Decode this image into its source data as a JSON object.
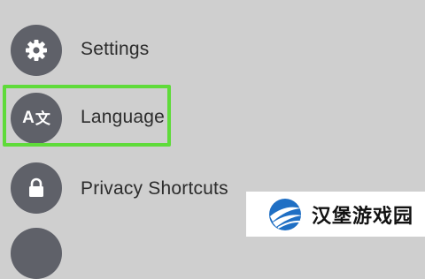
{
  "menu": {
    "items": [
      {
        "id": "settings",
        "label": "Settings",
        "icon": "gear-icon"
      },
      {
        "id": "language",
        "label": "Language",
        "icon": "translate-icon",
        "icon_text_latin": "A",
        "icon_text_cjk": "文",
        "highlighted": true
      },
      {
        "id": "privacy",
        "label": "Privacy Shortcuts",
        "icon": "lock-icon"
      },
      {
        "id": "partial",
        "label": "",
        "icon": "menu-icon"
      }
    ]
  },
  "watermark": {
    "text": "汉堡游戏园",
    "logo_icon": "watermark-logo"
  },
  "colors": {
    "background": "#cfcfcf",
    "icon_circle": "#5f6169",
    "highlight": "#5fdb3a",
    "label_text": "#2c2c2c"
  }
}
